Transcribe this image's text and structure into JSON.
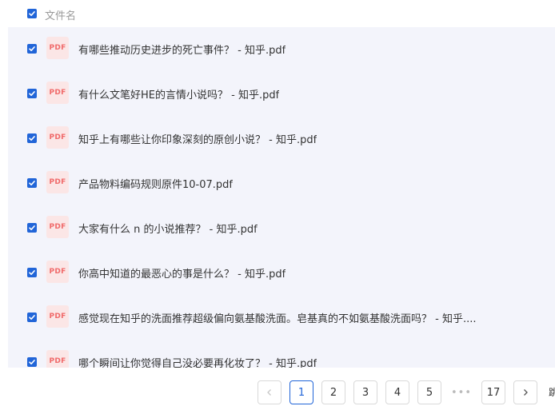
{
  "header": {
    "column_title": "文件名",
    "select_all_checked": true
  },
  "files": [
    {
      "icon": "pdf-file-icon",
      "icon_label": "PDF",
      "name": "有哪些推动历史进步的死亡事件？ - 知乎.pdf",
      "checked": true
    },
    {
      "icon": "pdf-file-icon",
      "icon_label": "PDF",
      "name": "有什么文笔好HE的言情小说吗？ - 知乎.pdf",
      "checked": true
    },
    {
      "icon": "pdf-file-icon",
      "icon_label": "PDF",
      "name": "知乎上有哪些让你印象深刻的原创小说？ - 知乎.pdf",
      "checked": true
    },
    {
      "icon": "pdf-file-icon",
      "icon_label": "PDF",
      "name": "产品物料编码规则原件10-07.pdf",
      "checked": true
    },
    {
      "icon": "pdf-file-icon",
      "icon_label": "PDF",
      "name": "大家有什么 n 的小说推荐？ - 知乎.pdf",
      "checked": true
    },
    {
      "icon": "pdf-file-icon",
      "icon_label": "PDF",
      "name": "你高中知道的最恶心的事是什么？ - 知乎.pdf",
      "checked": true
    },
    {
      "icon": "pdf-file-icon",
      "icon_label": "PDF",
      "name": "感觉现在知乎的洗面推荐超级偏向氨基酸洗面。皂基真的不如氨基酸洗面吗？ - 知乎....",
      "checked": true
    },
    {
      "icon": "pdf-file-icon",
      "icon_label": "PDF",
      "name": "哪个瞬间让你觉得自己没必要再化妆了？ - 知乎.pdf",
      "checked": true
    }
  ],
  "pagination": {
    "prev_icon": "chevron-left-icon",
    "next_icon": "chevron-right-icon",
    "pages": [
      "1",
      "2",
      "3",
      "4",
      "5"
    ],
    "ellipsis": "•••",
    "last_page": "17",
    "current_page": "1",
    "edge_text": "跳"
  },
  "colors": {
    "accent": "#2165d8",
    "list_bg": "#f3f4fb",
    "pdf_icon_bg": "#fbe6e6",
    "pdf_icon_text": "#f06a6a"
  }
}
